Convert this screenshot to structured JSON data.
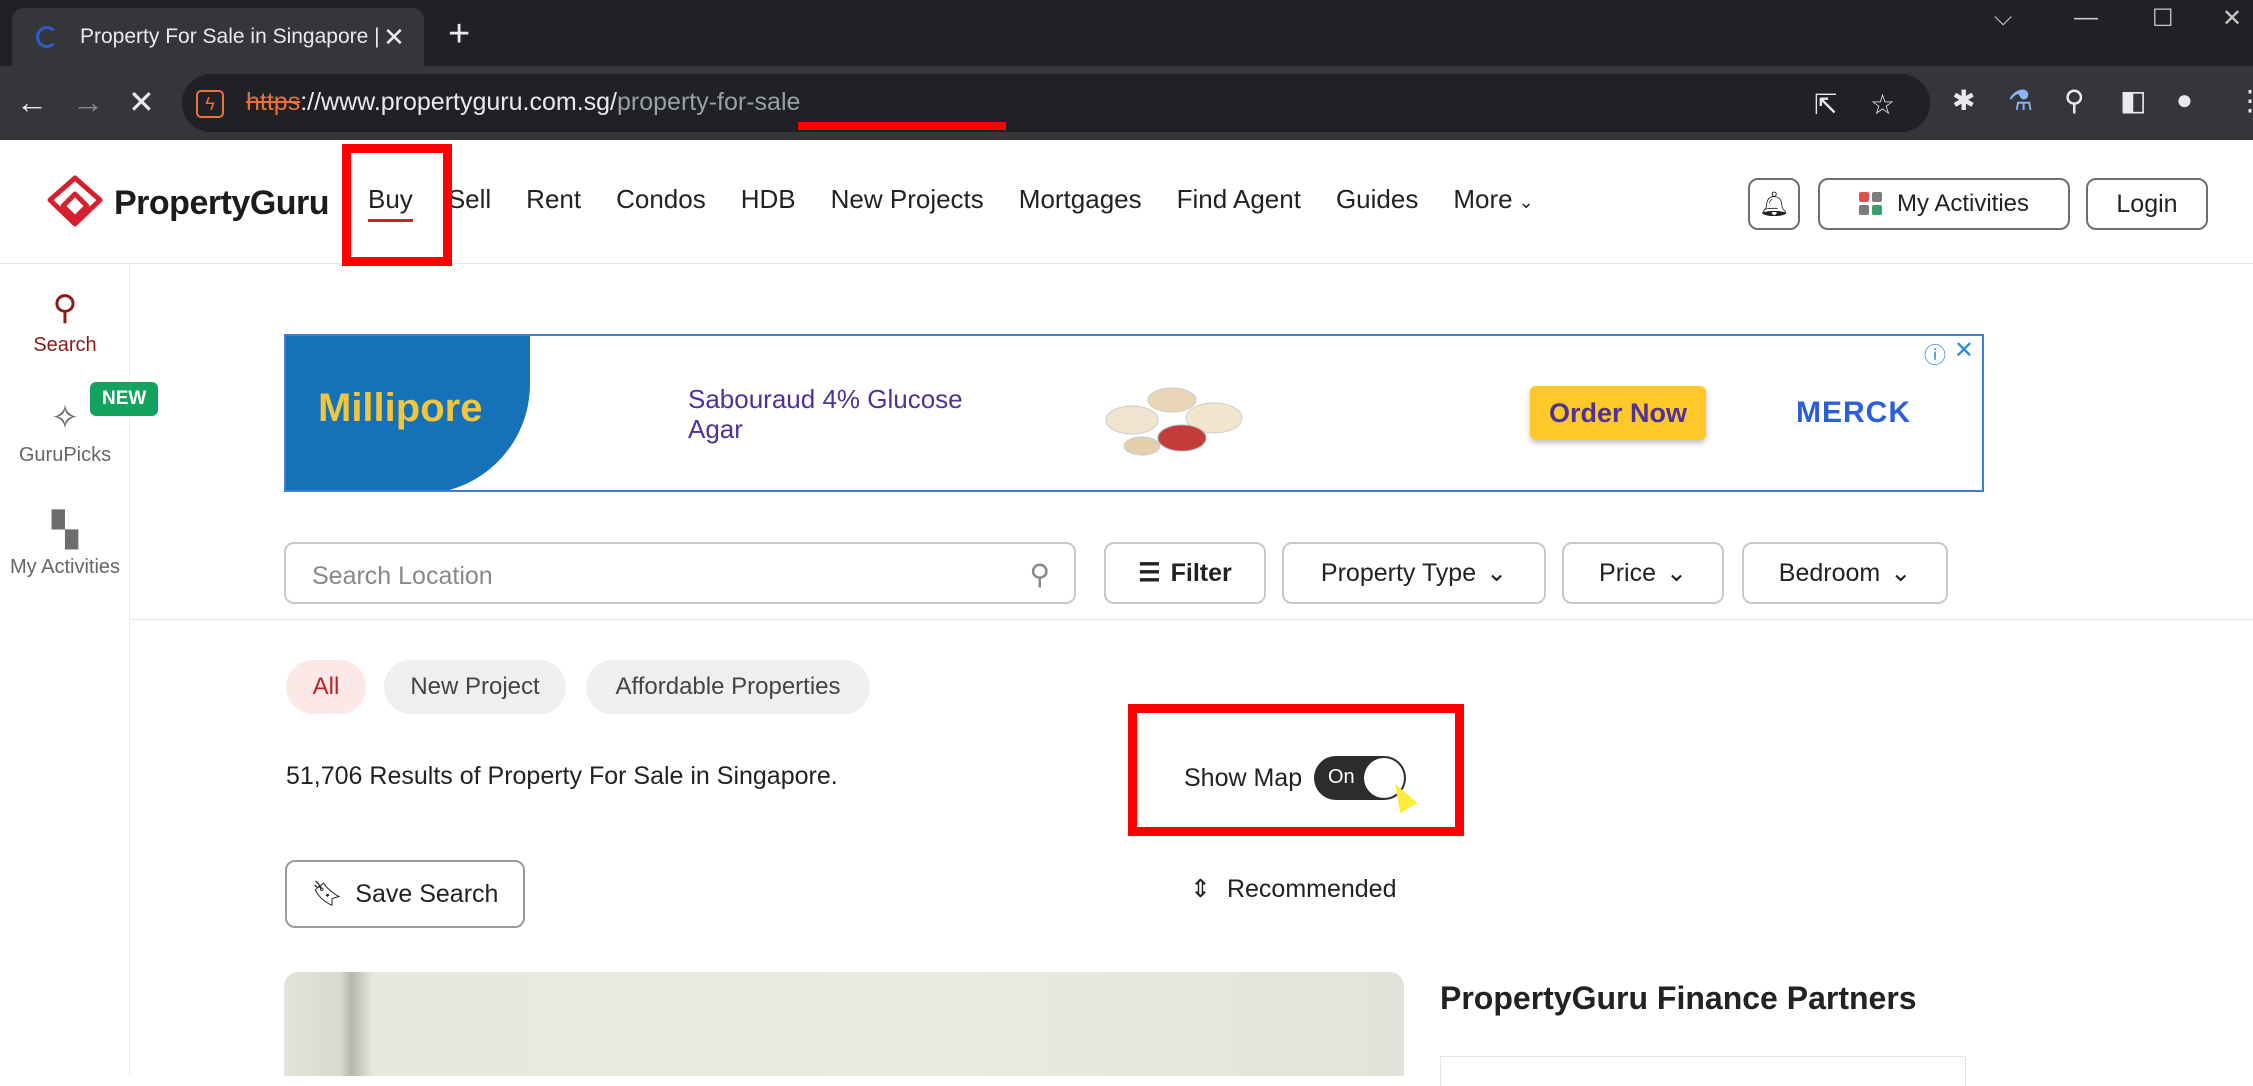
{
  "browser": {
    "tab_title": "Property For Sale in Singapore |",
    "url_scheme": "https",
    "url_host": "://www.propertyguru.com.sg/",
    "url_path": "property-for-sale"
  },
  "header": {
    "logo_text": "PropertyGuru",
    "nav": [
      "Buy",
      "Sell",
      "Rent",
      "Condos",
      "HDB",
      "New Projects",
      "Mortgages",
      "Find Agent",
      "Guides",
      "More"
    ],
    "active_nav": "Buy",
    "activities_label": "My Activities",
    "login_label": "Login"
  },
  "rail": {
    "search_label": "Search",
    "gurupicks_label": "GuruPicks",
    "new_badge": "NEW",
    "activities_label": "My Activities"
  },
  "ad": {
    "brand": "Millipore",
    "product": "Sabouraud 4% Glucose Agar",
    "cta": "Order Now",
    "sponsor": "MERCK"
  },
  "search": {
    "placeholder": "Search Location",
    "filter_label": "Filter",
    "property_type_label": "Property Type",
    "price_label": "Price",
    "bedroom_label": "Bedroom"
  },
  "chips": [
    "All",
    "New Project",
    "Affordable Properties"
  ],
  "results_text": "51,706 Results of Property For Sale in Singapore.",
  "map_toggle": {
    "label": "Show Map",
    "state": "On"
  },
  "save_search_label": "Save Search",
  "sort_label": "Recommended",
  "finance_title": "PropertyGuru Finance Partners",
  "colors": {
    "brand_red": "#d6202e",
    "annotation_red": "#ff0000",
    "ad_blue": "#1672b8",
    "ad_yellow": "#ffc82a"
  }
}
